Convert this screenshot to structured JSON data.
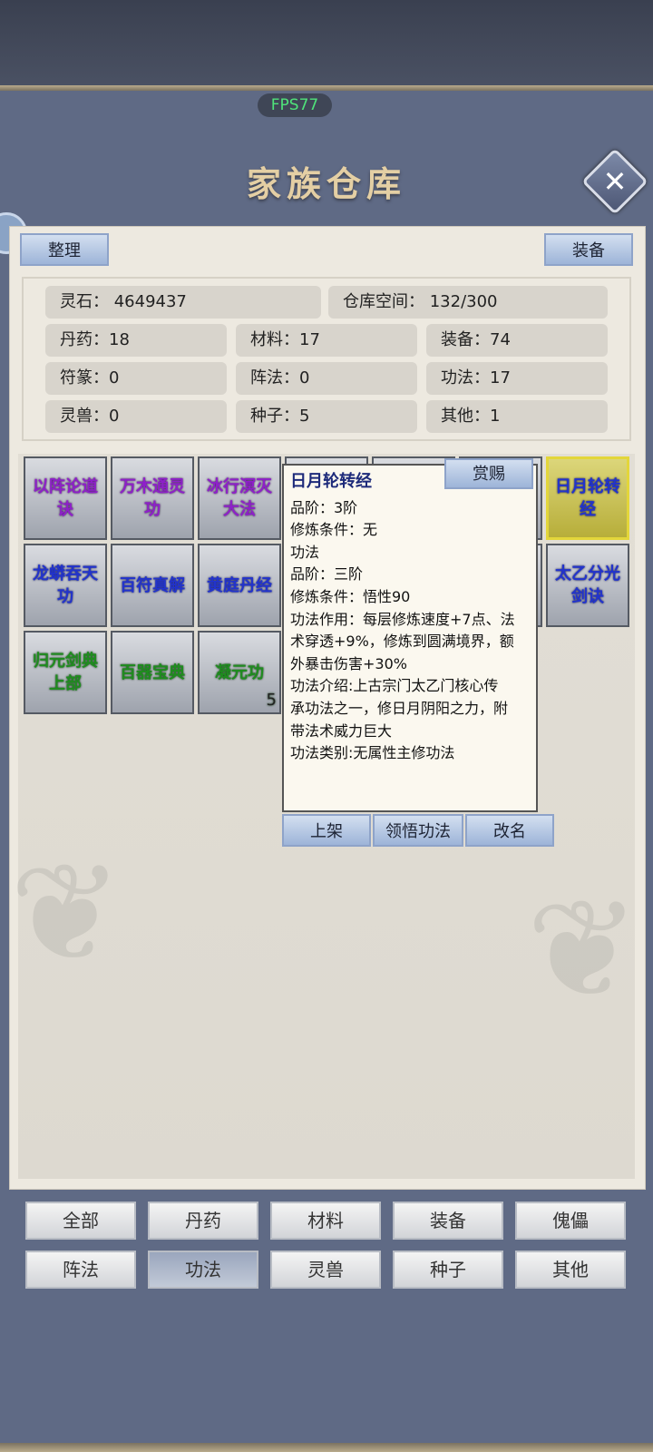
{
  "hud": {
    "fps": "FPS77"
  },
  "window": {
    "title": "家族仓库"
  },
  "toolbar": {
    "sort_label": "整理",
    "equip_label": "装备"
  },
  "stats": {
    "spirit_stone": "灵石：  4649437",
    "capacity": "仓库空间：    132/300",
    "pills": "丹药：18",
    "materials": "材料：17",
    "equipment": "装备：74",
    "talismans": "符篆：0",
    "formations": "阵法：0",
    "techniques": "功法：17",
    "beasts": "灵兽：0",
    "seeds": "种子：5",
    "others": "其他：1"
  },
  "items": [
    {
      "name": "以阵论道诀",
      "grade": "purple"
    },
    {
      "name": "万木通灵功",
      "grade": "purple"
    },
    {
      "name": "冰行溟灭大法",
      "grade": "purple"
    },
    {
      "name": "日月轮转经",
      "grade": "blue",
      "selected": true
    },
    {
      "name": "龙蟒吞天功",
      "grade": "blue"
    },
    {
      "name": "百符真解",
      "grade": "blue"
    },
    {
      "name": "黄庭丹经",
      "grade": "blue"
    },
    {
      "name": "太乙分光剑诀",
      "grade": "blue"
    },
    {
      "name": "归元剑典上部",
      "grade": "green"
    },
    {
      "name": "百器宝典",
      "grade": "green"
    },
    {
      "name": "凝元功",
      "grade": "green",
      "count": "5"
    }
  ],
  "tooltip": {
    "title": "日月轮转经",
    "reward_label": "赏赐",
    "lines": [
      "品阶：3阶",
      "修炼条件：无",
      "功法",
      "品阶：三阶",
      "修炼条件：悟性90",
      "功法作用：每层修炼速度+7点、法",
      "术穿透+9%，修炼到圆满境界，额",
      "外暴击伤害+30%",
      "功法介绍:上古宗门太乙门核心传",
      "承功法之一，修日月阴阳之力，附",
      "带法术威力巨大",
      "功法类别:无属性主修功法"
    ],
    "actions": [
      "上架",
      "领悟功法",
      "改名"
    ]
  },
  "categories": {
    "active": "功法",
    "row1": [
      "全部",
      "丹药",
      "材料",
      "装备",
      "傀儡"
    ],
    "row2": [
      "阵法",
      "功法",
      "灵兽",
      "种子",
      "其他"
    ]
  },
  "colors": {
    "purple": "#8e20c9",
    "blue": "#2233cc",
    "green": "#1f8c1f",
    "selected_border": "#e3d63a"
  }
}
